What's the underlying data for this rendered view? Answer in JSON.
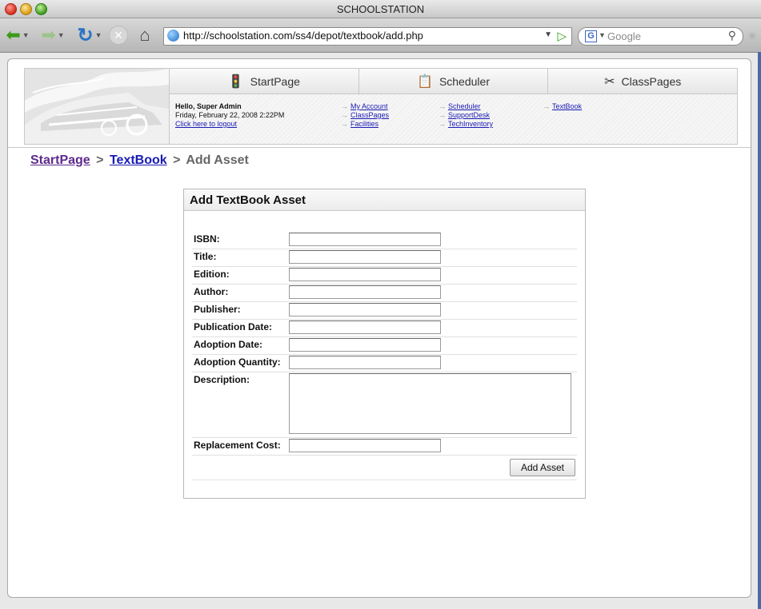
{
  "window": {
    "title": "SCHOOLSTATION"
  },
  "browser": {
    "url": "http://schoolstation.com/ss4/depot/textbook/add.php",
    "search_placeholder": "Google",
    "search_engine_letter": "G"
  },
  "header": {
    "tabs": [
      {
        "label": "StartPage",
        "icon": "traffic-light-icon"
      },
      {
        "label": "Scheduler",
        "icon": "notepad-icon"
      },
      {
        "label": "ClassPages",
        "icon": "scissors-icon"
      }
    ],
    "greeting": "Hello, Super Admin",
    "date": "Friday, February 22, 2008 2:22PM",
    "logout": "Click here to logout",
    "links": {
      "col1": [
        "My Account",
        "ClassPages",
        "Facilities"
      ],
      "col2": [
        "Scheduler",
        "SupportDesk",
        "TechInventory"
      ],
      "col3": [
        "TextBook"
      ]
    }
  },
  "breadcrumb": {
    "start": "StartPage",
    "sep": ">",
    "textbook": "TextBook",
    "current": "Add Asset"
  },
  "form": {
    "title": "Add TextBook Asset",
    "labels": {
      "isbn": "ISBN:",
      "title": "Title:",
      "edition": "Edition:",
      "author": "Author:",
      "publisher": "Publisher:",
      "publication_date": "Publication Date:",
      "adoption_date": "Adoption Date:",
      "adoption_quantity": "Adoption Quantity:",
      "description": "Description:",
      "replacement_cost": "Replacement Cost:"
    },
    "submit_label": "Add Asset"
  }
}
